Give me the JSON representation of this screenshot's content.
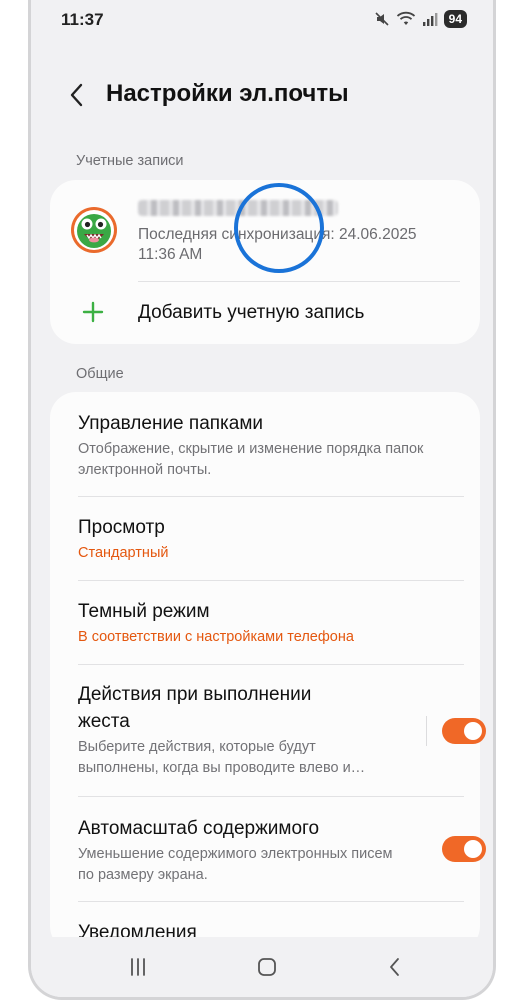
{
  "status_bar": {
    "time": "11:37",
    "battery": "94",
    "icons": [
      "mute-icon",
      "wifi-icon",
      "signal-icon",
      "battery-icon"
    ]
  },
  "header": {
    "title": "Настройки эл.почты",
    "back_icon": "chevron-left-icon"
  },
  "accounts": {
    "section_label": "Учетные записи",
    "account": {
      "name": "██████████████",
      "sync_line1": "Последняя синхронизация: 24.06.2025",
      "sync_line2": "11:36 AM",
      "highlight_color": "#1a73d8"
    },
    "add_label": "Добавить учетную запись"
  },
  "general": {
    "section_label": "Общие",
    "items": [
      {
        "title": "Управление папками",
        "subtitle": "Отображение, скрытие и изменение порядка папок электронной почты."
      },
      {
        "title": "Просмотр",
        "subtitle": "Стандартный"
      },
      {
        "title": "Темный режим",
        "subtitle": "В соответствии с настройками телефона"
      },
      {
        "title": "Действия при выполнении жеста",
        "subtitle": "Выберите действия, которые будут выполнены, когда вы проводите влево и…",
        "toggle": true
      },
      {
        "title": "Автомасштаб содержимого",
        "subtitle": "Уменьшение содержимого электронных писем по размеру экрана.",
        "toggle": true
      },
      {
        "title": "Уведомления"
      }
    ]
  },
  "colors": {
    "accent": "#f06827",
    "value_text": "#e4570f",
    "add_plus": "#3cb043"
  },
  "nav_bar": {
    "icons": [
      "recents-icon",
      "home-icon",
      "back-icon"
    ]
  }
}
